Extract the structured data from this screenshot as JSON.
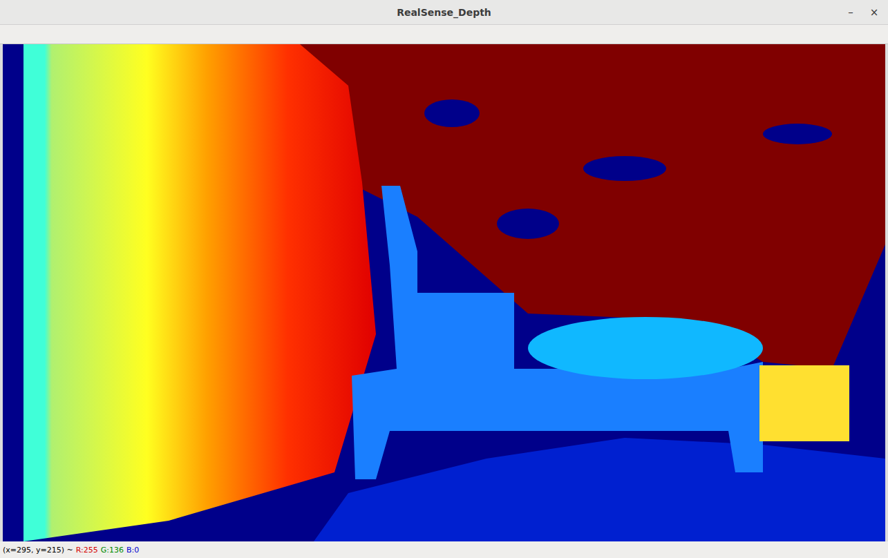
{
  "window": {
    "title": "RealSense_Depth",
    "controls": [
      "–",
      "×"
    ]
  },
  "status_bar": {
    "position": "(x=295, y=215) ~",
    "pixel": [
      {
        "label": "R:255",
        "color": "#d40000"
      },
      {
        "label": "G:136",
        "color": "#008a00"
      },
      {
        "label": "B:0",
        "color": "#0000d0"
      }
    ]
  }
}
